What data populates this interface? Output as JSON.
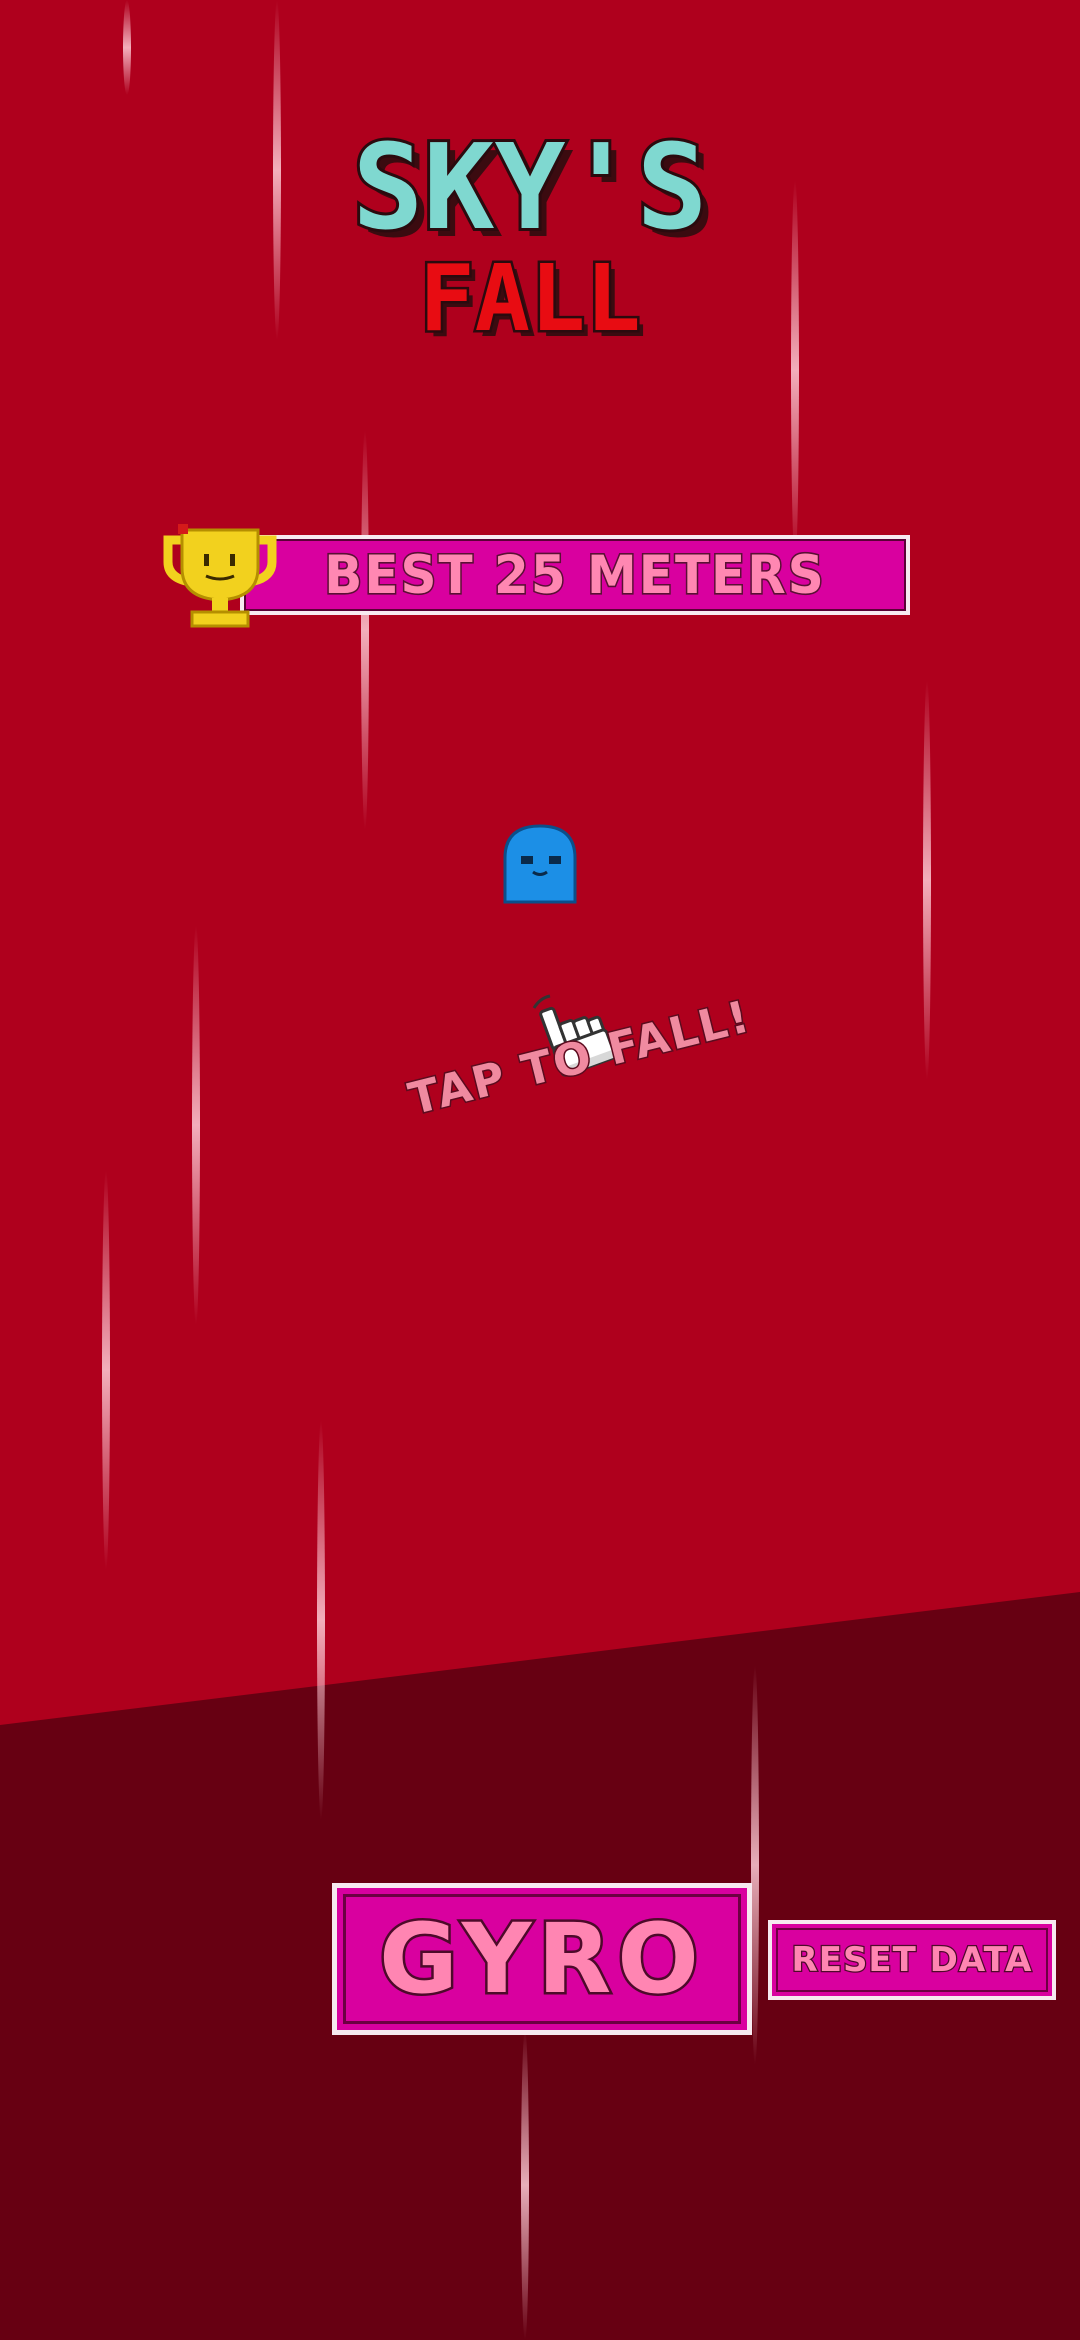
{
  "game": {
    "title_line1": "SKY'S",
    "title_line2": "FALL",
    "best_score_text": "BEST 25 METERS",
    "tap_hint": "TAP TO FALL!",
    "buttons": {
      "gyro": "GYRO",
      "reset": "RESET DATA"
    }
  },
  "colors": {
    "sky_background": "#af001d",
    "floor_background": "#670012",
    "panel_magenta": "#d9009f",
    "text_pink": "#ff85b2",
    "title_teal": "#7fd8d0",
    "title_red": "#e80c12",
    "character_blue": "#1c8fe6",
    "trophy_gold": "#f2d11e"
  },
  "icons": {
    "trophy": "trophy-icon",
    "hand": "pointing-hand-icon",
    "character": "blue-blob-character"
  }
}
